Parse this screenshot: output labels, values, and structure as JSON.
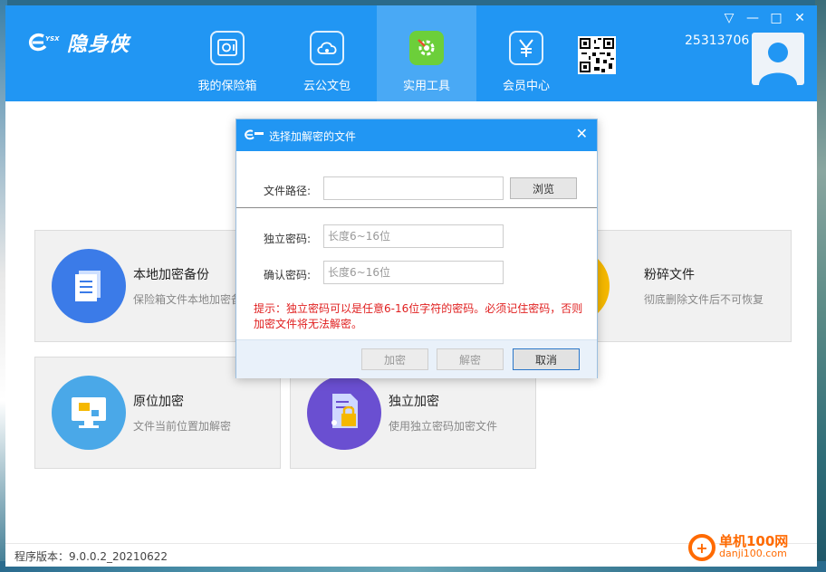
{
  "window": {
    "brand": "隐身侠",
    "controls": [
      "▽",
      "—",
      "□",
      "✕"
    ]
  },
  "nav": [
    {
      "label": "我的保险箱",
      "icon": "safe-icon"
    },
    {
      "label": "云公文包",
      "icon": "cloud-icon"
    },
    {
      "label": "实用工具",
      "icon": "tools-icon",
      "active": true
    },
    {
      "label": "会员中心",
      "icon": "yen-icon"
    }
  ],
  "user": {
    "id": "25313706"
  },
  "cards": [
    {
      "title": "本地加密备份",
      "desc": "保险箱文件本地加密备",
      "color": "#3b7be8",
      "icon": "document-icon"
    },
    {
      "title": "粉碎文件",
      "desc": "彻底删除文件后不可恢复",
      "color": "#f5b800",
      "icon": "shredder-icon"
    },
    {
      "title": "原位加密",
      "desc": "文件当前位置加解密",
      "color": "#4aa8e8",
      "icon": "monitor-lock-icon"
    },
    {
      "title": "独立加密",
      "desc": "使用独立密码加密文件",
      "color": "#6a4fd1",
      "icon": "file-lock-icon"
    }
  ],
  "status": {
    "version": "程序版本：9.0.0.2_20210622"
  },
  "dialog": {
    "title": "选择加解密的文件",
    "path_label": "文件路径:",
    "path_value": "",
    "browse_label": "浏览",
    "pwd_label": "独立密码:",
    "pwd_placeholder": "长度6~16位",
    "confirm_label": "确认密码:",
    "confirm_placeholder": "长度6~16位",
    "hint": "提示：独立密码可以是任意6-16位字符的密码。必须记住密码，否则加密文件将无法解密。",
    "encrypt_label": "加密",
    "decrypt_label": "解密",
    "cancel_label": "取消"
  },
  "watermark": {
    "main": "单机100网",
    "sub": "danji100.com"
  },
  "colors": {
    "header": "#2196f3",
    "active_tool": "#6ccf3a",
    "hint": "#e02020"
  }
}
